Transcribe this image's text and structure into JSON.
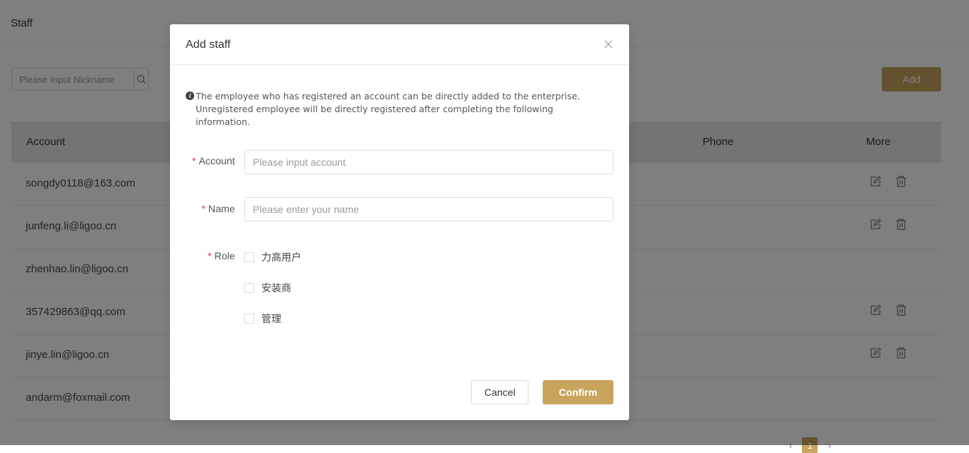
{
  "page": {
    "title": "Staff",
    "search_placeholder": "Please Input Nickname",
    "add_label": "Add",
    "table": {
      "headers": {
        "account": "Account",
        "phone": "Phone",
        "more": "More"
      },
      "rows": [
        {
          "account": "songdy0118@163.com",
          "has_actions": true
        },
        {
          "account": "junfeng.li@ligoo.cn",
          "has_actions": true
        },
        {
          "account": "zhenhao.lin@ligoo.cn",
          "has_actions": false
        },
        {
          "account": "357429863@qq.com",
          "has_actions": true
        },
        {
          "account": "jinye.lin@ligoo.cn",
          "has_actions": true
        },
        {
          "account": "andarm@foxmail.com",
          "has_actions": false
        }
      ]
    },
    "pagination": {
      "prev": "‹",
      "current": "1",
      "next": "›"
    }
  },
  "modal": {
    "title": "Add staff",
    "notice": "The employee who has registered an account can be directly added to the enterprise. Unregistered employee will be directly registered after completing the following information.",
    "fields": {
      "account": {
        "label": "Account",
        "placeholder": "Please input account"
      },
      "name": {
        "label": "Name",
        "placeholder": "Please enter your name"
      },
      "role": {
        "label": "Role",
        "options": [
          "力高用户",
          "安装商",
          "管理"
        ]
      }
    },
    "required_mark": "*",
    "cancel_label": "Cancel",
    "confirm_label": "Confirm"
  },
  "colors": {
    "accent": "#c9a45c",
    "required": "#e4393c",
    "overlay": "rgba(0,0,0,0.5)"
  }
}
